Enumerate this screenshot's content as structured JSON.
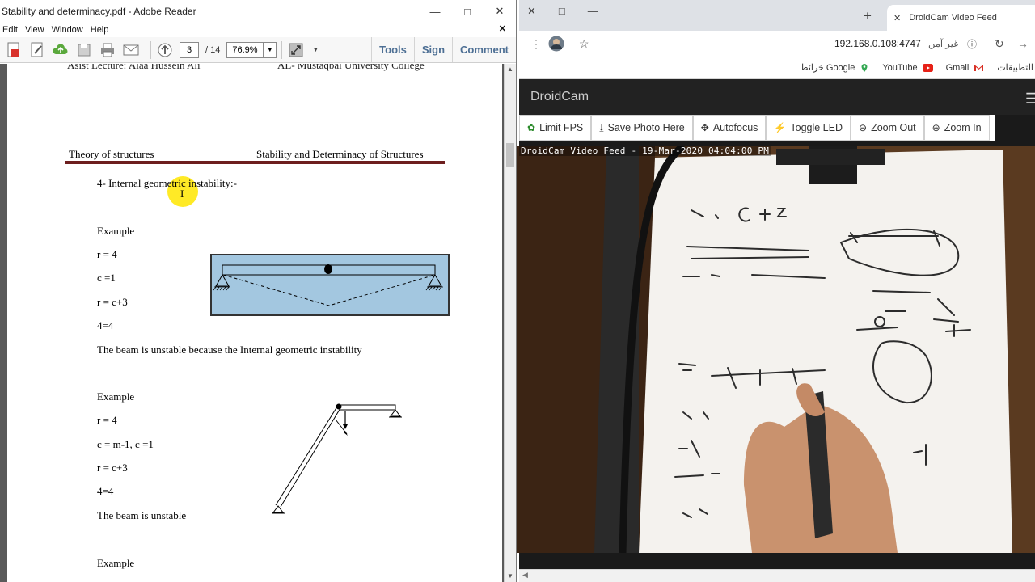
{
  "reader": {
    "title": "Stability and determinacy.pdf - Adobe Reader",
    "menu": [
      "Edit",
      "View",
      "Window",
      "Help"
    ],
    "page_current": "3",
    "page_total": "/ 14",
    "zoom": "76.9%",
    "tools": {
      "tools": "Tools",
      "sign": "Sign",
      "comment": "Comment"
    },
    "page1_header_left": "Asist Lecture: Alaa Hussein Ali",
    "page1_header_right": "AL- Mustaqbal University College",
    "running_head_left": "Theory of structures",
    "running_head_right": "Stability and Determinacy of Structures",
    "section": "4-  Internal geometric instability:-",
    "example1": {
      "label": "Example",
      "lines": [
        "r = 4",
        "c =1",
        "r = c+3",
        "4=4"
      ],
      "conclusion": "The beam is unstable because the Internal geometric instability"
    },
    "example2": {
      "label": "Example",
      "lines": [
        "r = 4",
        "c = m-1,   c =1",
        "r = c+3",
        "4=4"
      ],
      "conclusion": "The beam is unstable"
    },
    "example3_label": "Example"
  },
  "chrome": {
    "tab_title": "DroidCam Video Feed",
    "url": "192.168.0.108:4747",
    "not_secure": "غير آمن",
    "bookmarks": [
      "التطبيقات",
      "Gmail",
      "YouTube",
      "خرائط Google"
    ],
    "droidcam": {
      "brand": "DroidCam",
      "buttons": [
        "Limit FPS",
        "Save Photo Here",
        "Autofocus",
        "Toggle LED",
        "Zoom Out",
        "Zoom In"
      ],
      "caption": "DroidCam Video Feed - 19-Mar-2020 04:04:00 PM"
    }
  },
  "colors": {
    "rule": "#6d1e1e",
    "figure_fill": "#a3c7e0",
    "tool_link": "#4d6f94"
  }
}
